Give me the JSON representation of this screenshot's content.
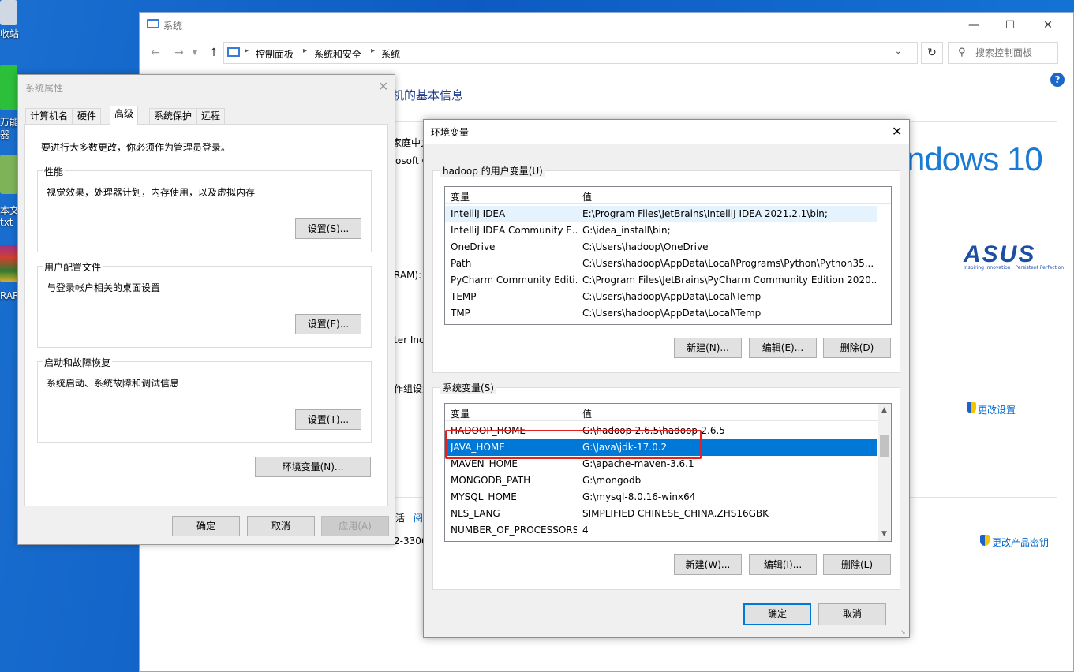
{
  "desktop": {
    "labels": [
      "收站",
      "万能",
      "器",
      "本文",
      "txt",
      "RAR"
    ]
  },
  "system_window": {
    "title": "系统",
    "breadcrumb": [
      "控制面板",
      "系统和安全",
      "系统"
    ],
    "search_placeholder": "搜索控制面板",
    "heading": "机的基本信息",
    "partial_texts": {
      "edition": "家庭中文",
      "copyright": "osoft C",
      "ram": "RAM):",
      "processor": "ter Inc",
      "workgroup": "作组设置",
      "activation": "活",
      "activation_link": "阅",
      "product_id": "2-3306"
    },
    "windows_logo": "ndows 10",
    "brand_logo": "ASUS",
    "brand_tagline": "Inspiring Innovation · Persistent Perfection",
    "change_settings": "更改设置",
    "change_key": "更改产品密钥"
  },
  "system_properties": {
    "title": "系统属性",
    "tabs": [
      "计算机名",
      "硬件",
      "高级",
      "系统保护",
      "远程"
    ],
    "active_tab": "高级",
    "admin_note": "要进行大多数更改，你必须作为管理员登录。",
    "groups": [
      {
        "title": "性能",
        "desc": "视觉效果，处理器计划，内存使用，以及虚拟内存",
        "button": "设置(S)..."
      },
      {
        "title": "用户配置文件",
        "desc": "与登录帐户相关的桌面设置",
        "button": "设置(E)..."
      },
      {
        "title": "启动和故障恢复",
        "desc": "系统启动、系统故障和调试信息",
        "button": "设置(T)..."
      }
    ],
    "env_button": "环境变量(N)...",
    "ok": "确定",
    "cancel": "取消",
    "apply": "应用(A)"
  },
  "env_vars": {
    "title": "环境变量",
    "user_section": "hadoop 的用户变量(U)",
    "system_section": "系统变量(S)",
    "col_var": "变量",
    "col_val": "值",
    "user_vars": [
      {
        "name": "IntelliJ IDEA",
        "value": "E:\\Program Files\\JetBrains\\IntelliJ IDEA 2021.2.1\\bin;"
      },
      {
        "name": "IntelliJ IDEA Community E...",
        "value": "G:\\idea_install\\bin;"
      },
      {
        "name": "OneDrive",
        "value": "C:\\Users\\hadoop\\OneDrive"
      },
      {
        "name": "Path",
        "value": "C:\\Users\\hadoop\\AppData\\Local\\Programs\\Python\\Python35..."
      },
      {
        "name": "PyCharm Community Editi...",
        "value": "C:\\Program Files\\JetBrains\\PyCharm Community Edition 2020...."
      },
      {
        "name": "TEMP",
        "value": "C:\\Users\\hadoop\\AppData\\Local\\Temp"
      },
      {
        "name": "TMP",
        "value": "C:\\Users\\hadoop\\AppData\\Local\\Temp"
      }
    ],
    "system_vars": [
      {
        "name": "HADOOP_HOME",
        "value": "G:\\hadoop-2.6.5\\hadoop-2.6.5"
      },
      {
        "name": "JAVA_HOME",
        "value": "G:\\Java\\jdk-17.0.2"
      },
      {
        "name": "MAVEN_HOME",
        "value": "G:\\apache-maven-3.6.1"
      },
      {
        "name": "MONGODB_PATH",
        "value": "G:\\mongodb"
      },
      {
        "name": "MYSQL_HOME",
        "value": "G:\\mysql-8.0.16-winx64"
      },
      {
        "name": "NLS_LANG",
        "value": "SIMPLIFIED CHINESE_CHINA.ZHS16GBK"
      },
      {
        "name": "NUMBER_OF_PROCESSORS",
        "value": "4"
      }
    ],
    "user_buttons": [
      "新建(N)...",
      "编辑(E)...",
      "删除(D)"
    ],
    "system_buttons": [
      "新建(W)...",
      "编辑(I)...",
      "删除(L)"
    ],
    "ok": "确定",
    "cancel": "取消"
  },
  "colors": {
    "accent": "#0078d7",
    "highlight": "#e81f1f",
    "heading": "#1e3f8a"
  }
}
